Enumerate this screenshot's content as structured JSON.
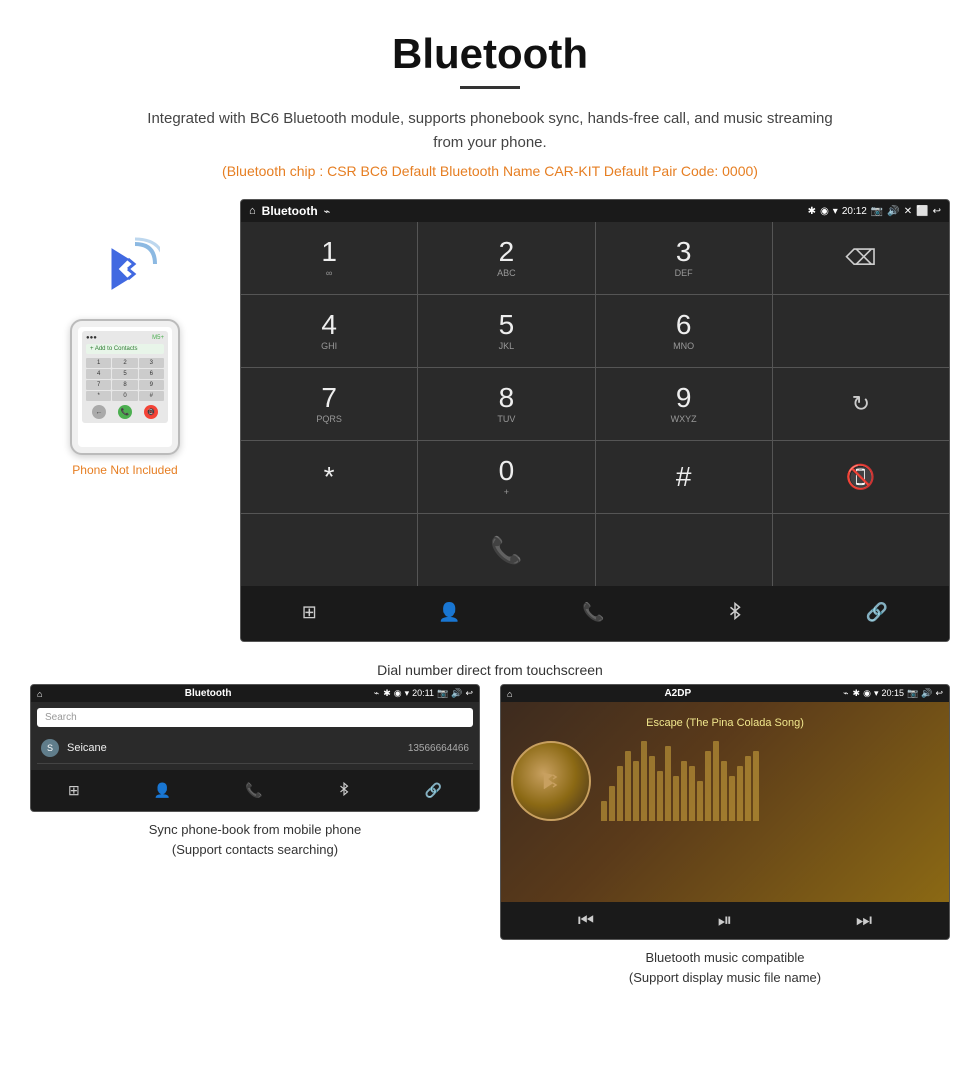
{
  "header": {
    "title": "Bluetooth",
    "description": "Integrated with BC6 Bluetooth module, supports phonebook sync, hands-free call, and music streaming from your phone.",
    "info_line": "(Bluetooth chip : CSR BC6    Default Bluetooth Name CAR-KIT    Default Pair Code: 0000)"
  },
  "dial_screen": {
    "status_bar": {
      "screen_name": "Bluetooth",
      "time": "20:12",
      "usb_icon": "⌁",
      "bt_icon": "✱",
      "location_icon": "◉",
      "signal_icon": "▾"
    },
    "keys": [
      {
        "num": "1",
        "sub": "∞",
        "row": 0,
        "col": 0
      },
      {
        "num": "2",
        "sub": "ABC",
        "row": 0,
        "col": 1
      },
      {
        "num": "3",
        "sub": "DEF",
        "row": 0,
        "col": 2
      },
      {
        "num": "",
        "sub": "",
        "row": 0,
        "col": 3,
        "special": "empty"
      },
      {
        "num": "4",
        "sub": "GHI",
        "row": 1,
        "col": 0
      },
      {
        "num": "5",
        "sub": "JKL",
        "row": 1,
        "col": 1
      },
      {
        "num": "6",
        "sub": "MNO",
        "row": 1,
        "col": 2
      },
      {
        "num": "",
        "sub": "",
        "row": 1,
        "col": 3,
        "special": "empty"
      },
      {
        "num": "7",
        "sub": "PQRS",
        "row": 2,
        "col": 0
      },
      {
        "num": "8",
        "sub": "TUV",
        "row": 2,
        "col": 1
      },
      {
        "num": "9",
        "sub": "WXYZ",
        "row": 2,
        "col": 2
      },
      {
        "num": "",
        "sub": "",
        "row": 2,
        "col": 3,
        "special": "refresh"
      },
      {
        "num": "*",
        "sub": "",
        "row": 3,
        "col": 0
      },
      {
        "num": "0",
        "sub": "+",
        "row": 3,
        "col": 1
      },
      {
        "num": "#",
        "sub": "",
        "row": 3,
        "col": 2
      },
      {
        "num": "",
        "sub": "",
        "row": 3,
        "col": 3,
        "special": "call-end"
      }
    ],
    "bottom_icons": [
      "grid",
      "person",
      "phone",
      "bluetooth",
      "link"
    ],
    "caption": "Dial number direct from touchscreen"
  },
  "phonebook_screen": {
    "status_bar": {
      "screen_name": "Bluetooth",
      "time": "20:11"
    },
    "search_placeholder": "Search",
    "contacts": [
      {
        "initial": "S",
        "name": "Seicane",
        "number": "13566664466"
      }
    ],
    "caption": "Sync phone-book from mobile phone\n(Support contacts searching)"
  },
  "music_screen": {
    "status_bar": {
      "screen_name": "A2DP",
      "time": "20:15"
    },
    "song_title": "Escape (The Pina Colada Song)",
    "eq_bars": [
      20,
      35,
      55,
      70,
      60,
      80,
      65,
      50,
      75,
      45,
      60,
      55,
      40,
      70,
      80,
      60,
      45,
      55,
      65,
      70
    ],
    "controls": [
      "prev",
      "play-pause",
      "next"
    ],
    "caption": "Bluetooth music compatible\n(Support display music file name)"
  },
  "phone_section": {
    "not_included_label": "Phone Not Included",
    "add_to_contacts_label": "+ Add to Contacts"
  }
}
